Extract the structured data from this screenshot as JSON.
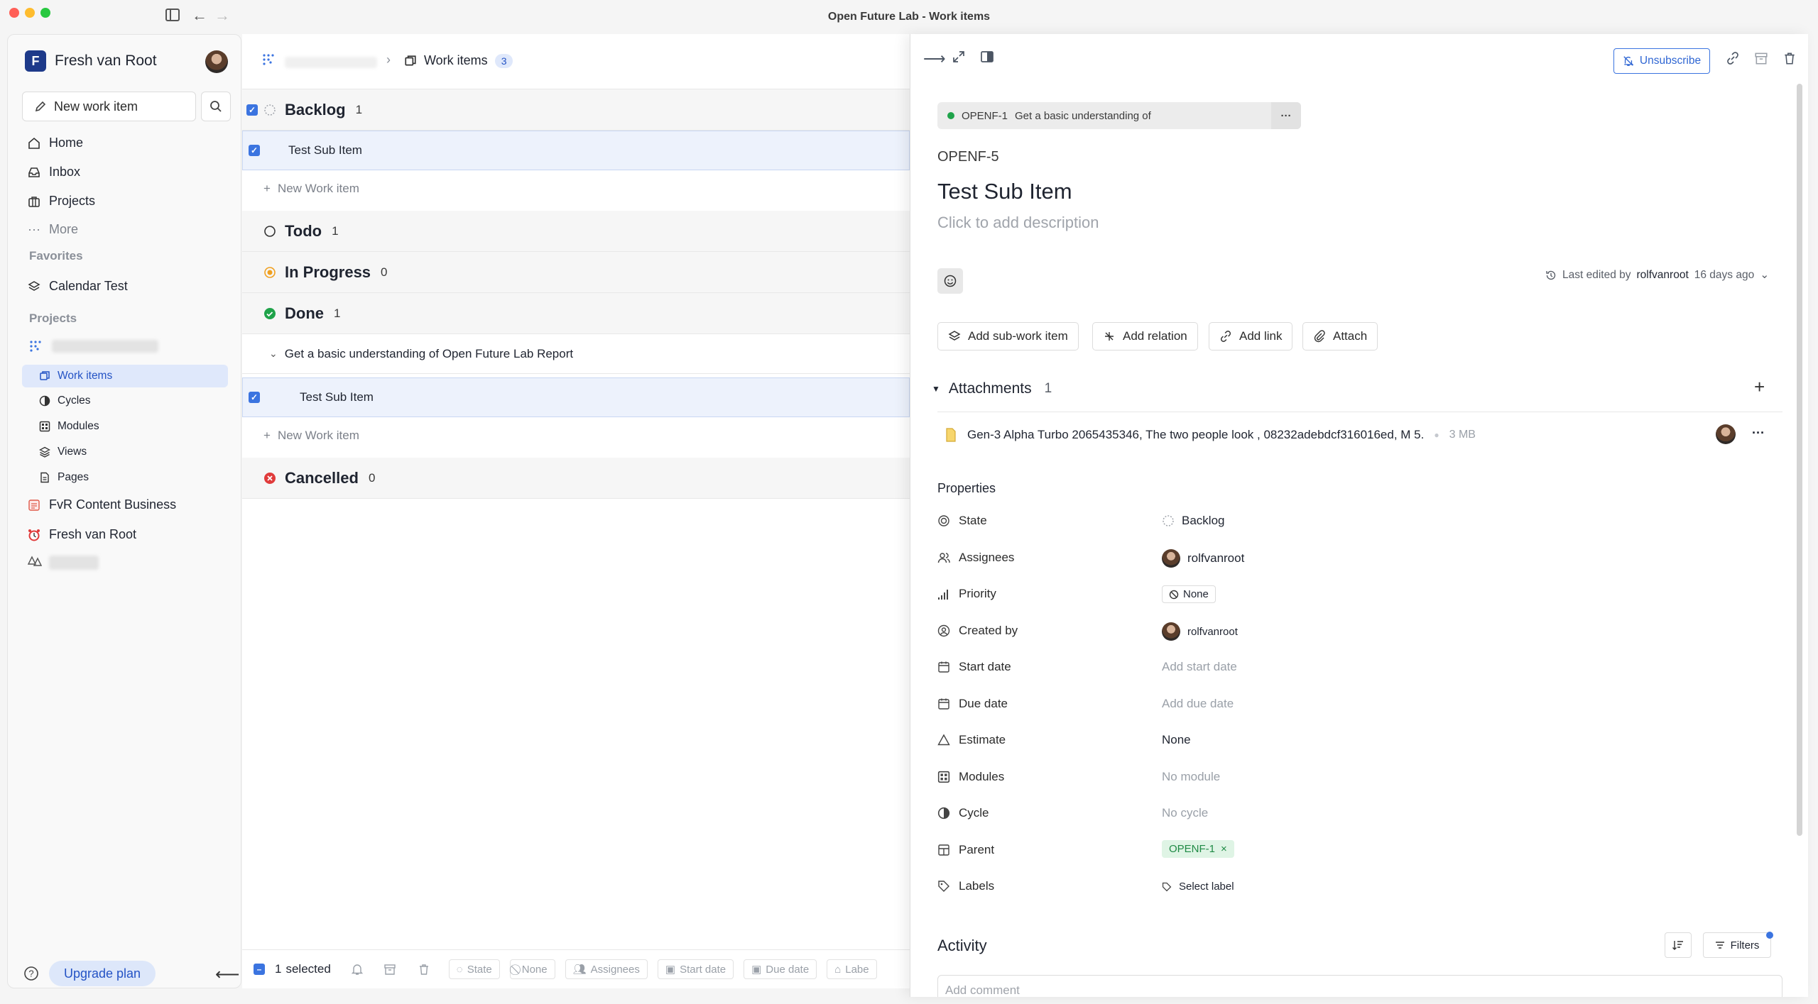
{
  "window": {
    "title": "Open Future Lab - Work items"
  },
  "sidebar": {
    "workspace": {
      "initial": "F",
      "name": "Fresh van Root"
    },
    "new_work_item": "New work item",
    "nav": [
      {
        "label": "Home",
        "icon": "home-icon"
      },
      {
        "label": "Inbox",
        "icon": "inbox-icon"
      },
      {
        "label": "Projects",
        "icon": "briefcase-icon"
      },
      {
        "label": "More",
        "icon": "more-icon"
      }
    ],
    "favorites_heading": "Favorites",
    "favorites": [
      {
        "label": "Calendar Test",
        "icon": "layers-icon"
      }
    ],
    "projects_heading": "Projects",
    "project_subitems": [
      {
        "label": "Work items",
        "icon": "work-items-icon",
        "active": true
      },
      {
        "label": "Cycles",
        "icon": "cycle-icon"
      },
      {
        "label": "Modules",
        "icon": "modules-icon"
      },
      {
        "label": "Views",
        "icon": "layers-icon"
      },
      {
        "label": "Pages",
        "icon": "page-icon"
      }
    ],
    "other_projects": [
      {
        "label": "FvR Content Business",
        "icon": "document-emoji-icon"
      },
      {
        "label": "Fresh van Root",
        "icon": "alarm-clock-emoji-icon"
      }
    ],
    "upgrade": "Upgrade plan"
  },
  "list": {
    "breadcrumb": "Work items",
    "count": "3",
    "groups": [
      {
        "title": "Backlog",
        "count": "1"
      },
      {
        "title": "Todo",
        "count": "1"
      },
      {
        "title": "In Progress",
        "count": "0"
      },
      {
        "title": "Done",
        "count": "1"
      },
      {
        "title": "Cancelled",
        "count": "0"
      }
    ],
    "items": {
      "backlog_item": "Test Sub Item",
      "parent_item": "Get a basic understanding of Open Future Lab Report",
      "done_sub_item": "Test Sub Item"
    },
    "new_work_item": "New Work item",
    "footer": {
      "selected_count": "1",
      "selected_label": "selected",
      "chips": [
        "State",
        "None",
        "Assignees",
        "Start date",
        "Due date",
        "Labe"
      ]
    }
  },
  "detail": {
    "unsubscribe": "Unsubscribe",
    "parent_pill": {
      "id": "OPENF-1",
      "title": "Get a basic understanding of"
    },
    "id": "OPENF-5",
    "title": "Test Sub Item",
    "description_placeholder": "Click to add description",
    "last_edited": {
      "prefix": "Last edited by",
      "user": "rolfvanroot",
      "when": "16 days ago"
    },
    "actions": [
      "Add sub-work item",
      "Add relation",
      "Add link",
      "Attach"
    ],
    "attachments": {
      "heading": "Attachments",
      "count": "1",
      "file": {
        "name": "Gen-3 Alpha Turbo 2065435346, The two people look , 08232adebdcf316016ed, M 5.",
        "size": "3 MB"
      }
    },
    "properties_heading": "Properties",
    "properties": {
      "state": {
        "label": "State",
        "value": "Backlog"
      },
      "assignees": {
        "label": "Assignees",
        "value": "rolfvanroot"
      },
      "priority": {
        "label": "Priority",
        "value": "None"
      },
      "created_by": {
        "label": "Created by",
        "value": "rolfvanroot"
      },
      "start_date": {
        "label": "Start date",
        "value": "Add start date"
      },
      "due_date": {
        "label": "Due date",
        "value": "Add due date"
      },
      "estimate": {
        "label": "Estimate",
        "value": "None"
      },
      "modules": {
        "label": "Modules",
        "value": "No module"
      },
      "cycle": {
        "label": "Cycle",
        "value": "No cycle"
      },
      "parent": {
        "label": "Parent",
        "value": "OPENF-1"
      },
      "labels": {
        "label": "Labels",
        "value": "Select label"
      }
    },
    "activity": {
      "heading": "Activity",
      "filters": "Filters",
      "comment_placeholder": "Add comment"
    }
  },
  "colors": {
    "accent": "#3b74e0",
    "done": "#1fa34a",
    "in_progress": "#f0a020",
    "cancelled": "#e03b3b",
    "parent_chip": "#1f8a45"
  }
}
